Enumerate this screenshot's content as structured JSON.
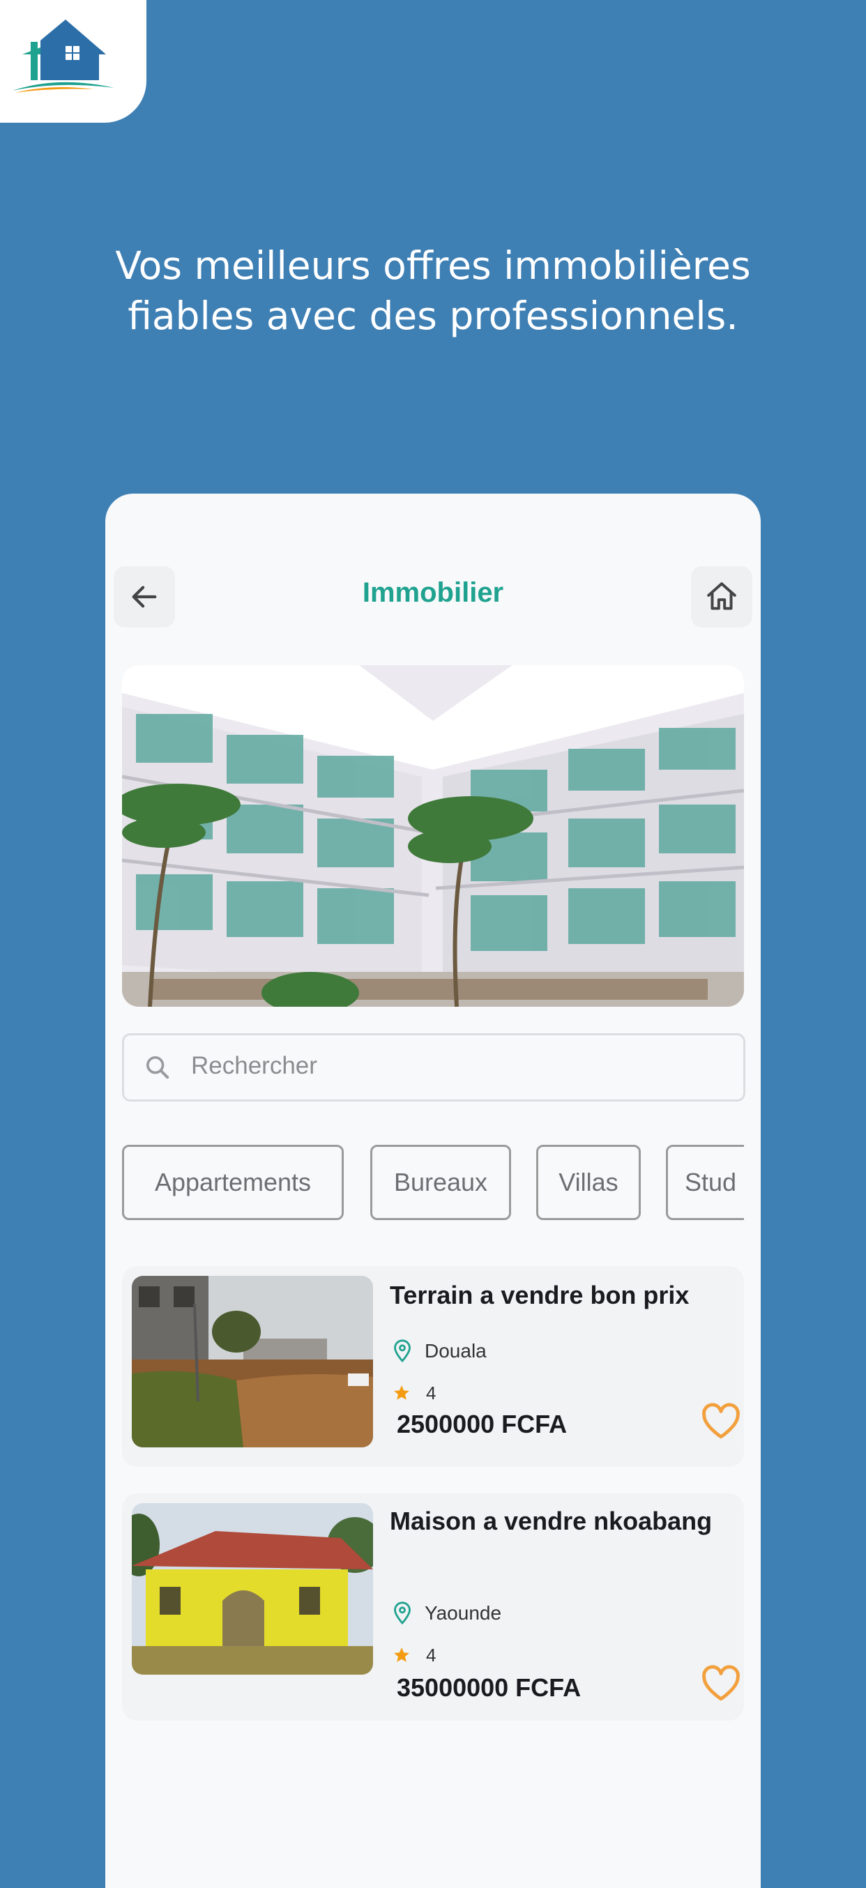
{
  "headline": {
    "line1": "Vos meilleurs offres immobilières",
    "line2": "fiables avec des professionnels."
  },
  "app": {
    "title": "Immobilier",
    "icons": {
      "back": "arrow-left-icon",
      "home": "home-icon",
      "search": "search-icon",
      "location": "location-pin-icon",
      "rating": "star-icon",
      "favorite": "heart-icon"
    },
    "colors": {
      "accent": "#1fa28f",
      "background": "#3e7fb4",
      "star": "#f39c12",
      "heart": "#f2a03d"
    }
  },
  "search": {
    "placeholder": "Rechercher"
  },
  "categories": [
    "Appartements",
    "Bureaux",
    "Villas",
    "Stud"
  ],
  "listings": [
    {
      "title": "Terrain a vendre bon prix",
      "location": "Douala",
      "rating": "4",
      "price": "2500000 FCFA"
    },
    {
      "title": "Maison a vendre nkoabang",
      "location": "Yaounde",
      "rating": "4",
      "price": "35000000 FCFA"
    }
  ]
}
